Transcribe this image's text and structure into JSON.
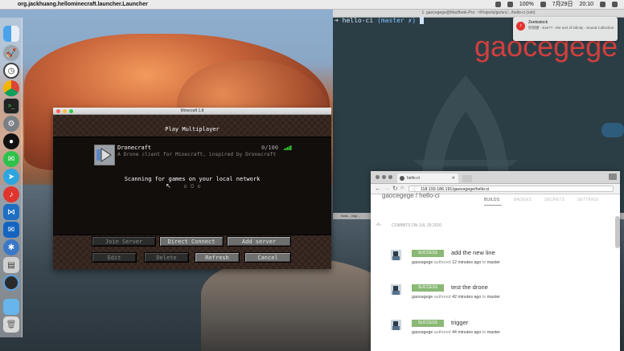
{
  "menubar": {
    "app_name": "org.jackhuang.hellominecraft.launcher.Launcher",
    "battery": "100%",
    "date": "7月29日",
    "time": "20:10"
  },
  "terminal": {
    "title": "1. gaocegege@MacBook-Pro: ~/Projects/go/src/.../hello-ci (zsh)",
    "prompt_dir": "hello-ci",
    "prompt_branch": "(master ✗)",
    "wallpaper_text": "gaocegege",
    "bottom_tab": "local-.../log/..."
  },
  "notification": {
    "app": "Zeetsstock",
    "title": "Zeetsstock",
    "body": "阿刻捷 - Eve?? - the sort of infinity - Sound Collection"
  },
  "minecraft": {
    "window_title": "Minecraft 1.8",
    "heading": "Play Multiplayer",
    "server_name": "Dronecraft",
    "server_desc": "A Drone client for Minecraft, inspired by Dronecraft",
    "server_count": "0/100",
    "scanning": "Scanning for games on your local network",
    "scanning_dots": "o O o",
    "buttons": {
      "join": "Join Server",
      "direct": "Direct Connect",
      "add": "Add server",
      "edit": "Edit",
      "delete": "Delete",
      "refresh": "Refresh",
      "cancel": "Cancel"
    }
  },
  "browser": {
    "tab_title": "hello-ci",
    "url": "118.193.186.191/gaocegege/hello-ci",
    "repo": "gaocegege / hello-ci",
    "tabs": [
      "BUILDS",
      "BADGES",
      "SECRETS",
      "SETTINGS"
    ],
    "commits_header": "COMMITS ON JUL 29 2016",
    "commits": [
      {
        "status": "SUCCESS",
        "message": "add the new line",
        "author": "gaocegege",
        "authored": "authored",
        "time": "12 minutes ago",
        "to": "to",
        "branch": "master"
      },
      {
        "status": "SUCCESS",
        "message": "test the drone",
        "author": "gaocegege",
        "authored": "authored",
        "time": "42 minutes ago",
        "to": "to",
        "branch": "master"
      },
      {
        "status": "SUCCESS",
        "message": "trigger",
        "author": "gaocegege",
        "authored": "authored",
        "time": "44 minutes ago",
        "to": "to",
        "branch": "master"
      }
    ]
  },
  "dock": {
    "icons": [
      "finder-icon",
      "launchpad-icon",
      "clock-icon",
      "chrome-icon",
      "terminal-icon",
      "system-preferences-icon",
      "qq-icon",
      "wechat-icon",
      "telegram-icon",
      "netease-music-icon",
      "vscode-icon",
      "outlook-icon",
      "xcode-icon",
      "printer-icon",
      "quicktime-icon",
      "folder-icon",
      "trash-icon"
    ]
  },
  "colors": {
    "success": "#8ab875",
    "prompt": "#7fc0ff",
    "brand_red": "#e5403f"
  }
}
